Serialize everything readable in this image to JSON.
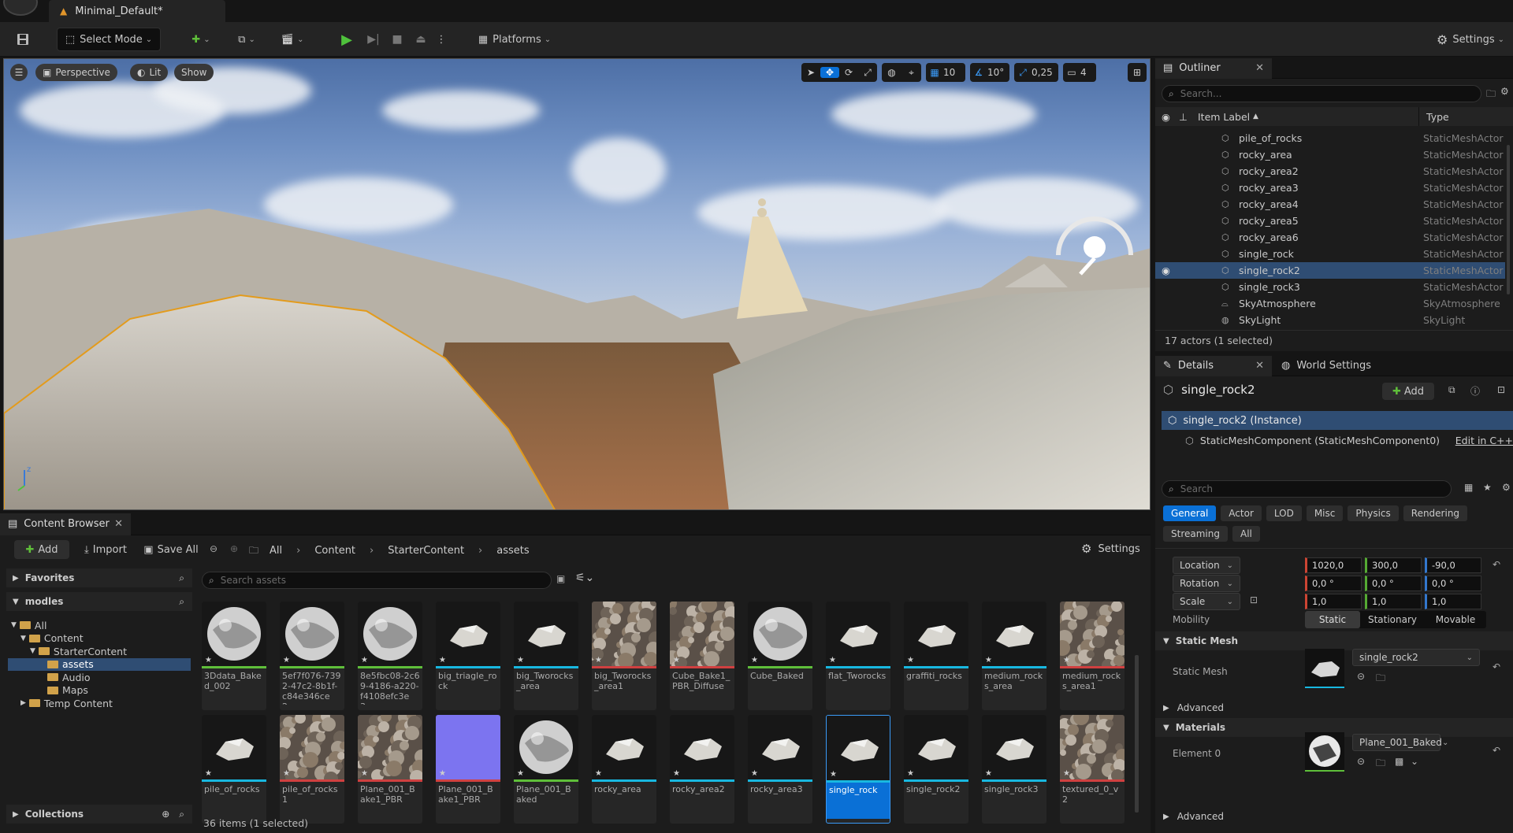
{
  "app": {
    "doc_title": "Minimal_Default*"
  },
  "toolbar": {
    "mode": "Select Mode",
    "platforms": "Platforms",
    "settings": "Settings"
  },
  "viewport": {
    "perspective": "Perspective",
    "lit": "Lit",
    "show": "Show",
    "grid_snap": "10",
    "angle_snap": "10°",
    "scale_snap": "0,25",
    "cam_speed": "4"
  },
  "outliner": {
    "tab": "Outliner",
    "search_placeholder": "Search...",
    "col_label": "Item Label",
    "col_type": "Type",
    "rows": [
      {
        "label": "pile_of_rocks",
        "type": "StaticMeshActor"
      },
      {
        "label": "rocky_area",
        "type": "StaticMeshActor"
      },
      {
        "label": "rocky_area2",
        "type": "StaticMeshActor"
      },
      {
        "label": "rocky_area3",
        "type": "StaticMeshActor"
      },
      {
        "label": "rocky_area4",
        "type": "StaticMeshActor"
      },
      {
        "label": "rocky_area5",
        "type": "StaticMeshActor"
      },
      {
        "label": "rocky_area6",
        "type": "StaticMeshActor"
      },
      {
        "label": "single_rock",
        "type": "StaticMeshActor"
      },
      {
        "label": "single_rock2",
        "type": "StaticMeshActor",
        "selected": true
      },
      {
        "label": "single_rock3",
        "type": "StaticMeshActor"
      },
      {
        "label": "SkyAtmosphere",
        "type": "SkyAtmosphere"
      },
      {
        "label": "SkyLight",
        "type": "SkyLight"
      }
    ],
    "status": "17 actors (1 selected)"
  },
  "details": {
    "tab": "Details",
    "tab2": "World Settings",
    "actor": "single_rock2",
    "add": "Add",
    "instance": "single_rock2 (Instance)",
    "component": "StaticMeshComponent (StaticMeshComponent0)",
    "edit_cpp": "Edit in C++",
    "search_placeholder": "Search",
    "filters": [
      "General",
      "Actor",
      "LOD",
      "Misc",
      "Physics",
      "Rendering",
      "Streaming",
      "All"
    ],
    "location": {
      "label": "Location",
      "x": "1020,0",
      "y": "300,0",
      "z": "-90,0"
    },
    "rotation": {
      "label": "Rotation",
      "x": "0,0 °",
      "y": "0,0 °",
      "z": "0,0 °"
    },
    "scale": {
      "label": "Scale",
      "x": "1,0",
      "y": "1,0",
      "z": "1,0"
    },
    "mobility": {
      "label": "Mobility",
      "options": [
        "Static",
        "Stationary",
        "Movable"
      ]
    },
    "static_mesh_section": "Static Mesh",
    "static_mesh_label": "Static Mesh",
    "static_mesh_value": "single_rock2",
    "advanced": "Advanced",
    "materials_section": "Materials",
    "element0": "Element 0",
    "material_value": "Plane_001_Baked",
    "advanced2": "Advanced"
  },
  "content_browser": {
    "tab": "Content Browser",
    "add": "Add",
    "import": "Import",
    "save_all": "Save All",
    "breadcrumb": [
      "All",
      "Content",
      "StarterContent",
      "assets"
    ],
    "settings": "Settings",
    "favorites": "Favorites",
    "modles": "modles",
    "tree": [
      "All",
      "Content",
      "StarterContent",
      "assets",
      "Audio",
      "Maps",
      "Temp Content"
    ],
    "search_placeholder": "Search assets",
    "collections": "Collections",
    "status": "36 items (1 selected)",
    "assets_row1": [
      {
        "name": "3Ddata_Baked_002",
        "bar": "#5fbf3a",
        "kind": "sphere"
      },
      {
        "name": "5ef7f076-7392-47c2-8b1f-c84e346ce2...",
        "bar": "#5fbf3a",
        "kind": "sphere"
      },
      {
        "name": "8e5fbc08-2c69-4186-a220-f4108efc3e3...",
        "bar": "#5fbf3a",
        "kind": "sphere"
      },
      {
        "name": "big_triagle_rock",
        "bar": "#18b8e0",
        "kind": "rock"
      },
      {
        "name": "big_Tworocks_area",
        "bar": "#18b8e0",
        "kind": "rock"
      },
      {
        "name": "big_Tworocks_area1",
        "bar": "#d04040",
        "kind": "tex"
      },
      {
        "name": "Cube_Bake1_PBR_Diffuse",
        "bar": "#d04040",
        "kind": "tex"
      },
      {
        "name": "Cube_Baked",
        "bar": "#5fbf3a",
        "kind": "sphere"
      },
      {
        "name": "flat_Tworocks",
        "bar": "#18b8e0",
        "kind": "rock"
      },
      {
        "name": "graffiti_rocks",
        "bar": "#18b8e0",
        "kind": "rock"
      },
      {
        "name": "medium_rocks_area",
        "bar": "#18b8e0",
        "kind": "rock"
      },
      {
        "name": "medium_rocks_area1",
        "bar": "#d04040",
        "kind": "tex"
      }
    ],
    "assets_row2": [
      {
        "name": "pile_of_rocks",
        "bar": "#18b8e0",
        "kind": "rock"
      },
      {
        "name": "pile_of_rocks1",
        "bar": "#d04040",
        "kind": "tex"
      },
      {
        "name": "Plane_001_Bake1_PBR",
        "bar": "#d04040",
        "kind": "tex"
      },
      {
        "name": "Plane_001_Bake1_PBR",
        "bar": "#d04040",
        "kind": "normal"
      },
      {
        "name": "Plane_001_Baked",
        "bar": "#5fbf3a",
        "kind": "sphere"
      },
      {
        "name": "rocky_area",
        "bar": "#18b8e0",
        "kind": "rock"
      },
      {
        "name": "rocky_area2",
        "bar": "#18b8e0",
        "kind": "rock"
      },
      {
        "name": "rocky_area3",
        "bar": "#18b8e0",
        "kind": "rock"
      },
      {
        "name": "single_rock",
        "bar": "#18b8e0",
        "kind": "rock",
        "selected": true
      },
      {
        "name": "single_rock2",
        "bar": "#18b8e0",
        "kind": "rock"
      },
      {
        "name": "single_rock3",
        "bar": "#18b8e0",
        "kind": "rock"
      },
      {
        "name": "textured_0_v2",
        "bar": "#d04040",
        "kind": "tex"
      }
    ]
  }
}
